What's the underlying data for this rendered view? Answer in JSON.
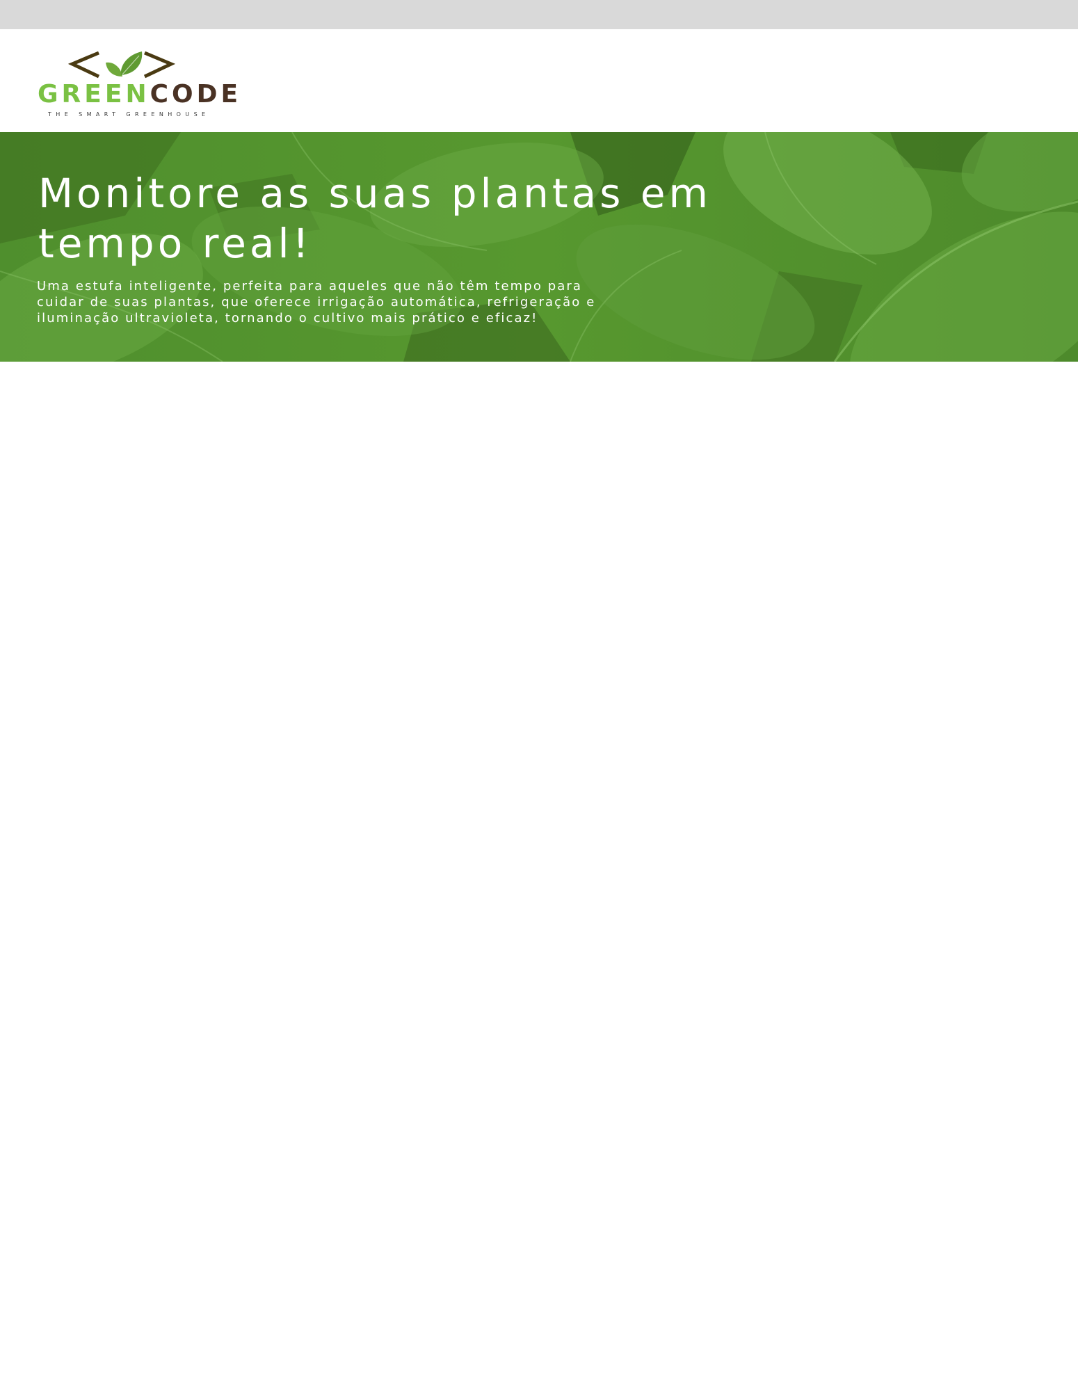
{
  "logo": {
    "word_green": "GREEN",
    "word_code": "CODE",
    "tagline": "THE SMART GREENHOUSE",
    "icon": "code-brackets-leaf-icon"
  },
  "hero": {
    "title": "Monitore as suas plantas em tempo real!",
    "description": "Uma estufa inteligente, perfeita para aqueles que não têm tempo para cuidar de suas plantas, que oferece irrigação automática, refrigeração e iluminação ultravioleta, tornando o cultivo mais prático e eficaz!",
    "background": "monstera-leaves-image"
  },
  "colors": {
    "top_strip": "#d9d9d9",
    "brand_green": "#7ac143",
    "brand_brown": "#4a3224",
    "hero_green": "#4e8f2c",
    "hero_text": "#ffffff"
  }
}
